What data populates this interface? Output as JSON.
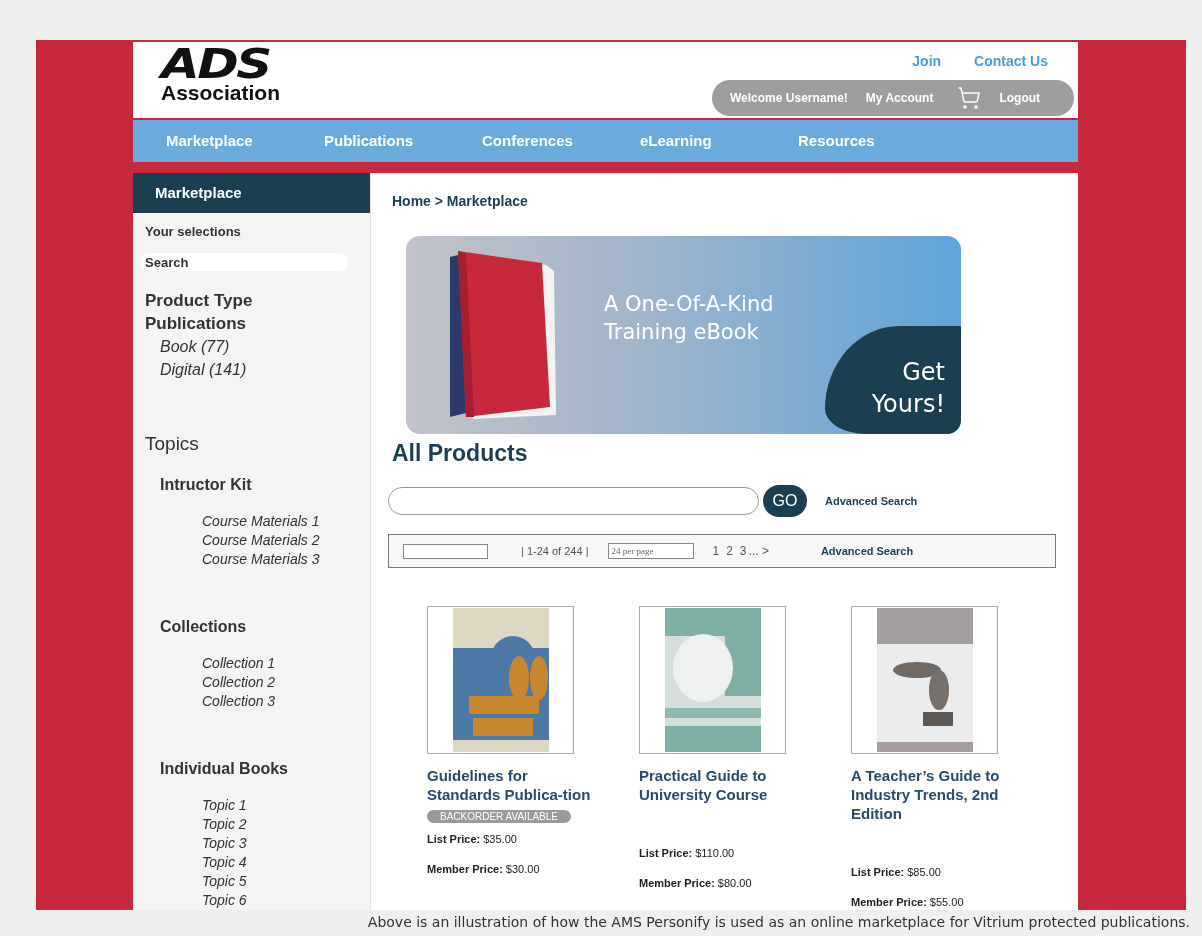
{
  "logo": {
    "mark": "ADS",
    "name": "Association"
  },
  "top_links": [
    "Join",
    "Contact Us"
  ],
  "user_bar": {
    "welcome": "Welcome Username!",
    "account": "My Account",
    "logout": "Logout"
  },
  "nav": [
    "Marketplace",
    "Publications",
    "Conferences",
    "eLearning",
    "Resources"
  ],
  "sidebar": {
    "title": "Marketplace",
    "selections": "Your selections",
    "search": {
      "placeholder": "Search"
    },
    "product_type": {
      "title": "Product Type",
      "subtitle": "Publications",
      "items": [
        "Book (77)",
        "Digital (141)"
      ]
    },
    "topics": {
      "title": "Topics",
      "groups": [
        {
          "title": "Intructor Kit",
          "items": [
            "Course Materials 1",
            "Course Materials 2",
            "Course Materials 3"
          ]
        },
        {
          "title": "Collections",
          "items": [
            "Collection 1",
            "Collection 2",
            "Collection 3"
          ]
        },
        {
          "title": "Individual Books",
          "items": [
            "Topic 1",
            "Topic 2",
            "Topic 3",
            "Topic 4",
            "Topic 5",
            "Topic 6"
          ]
        }
      ]
    }
  },
  "breadcrumb": "Home > Marketplace",
  "banner": {
    "headline": "A One-Of-A-Kind Training eBook",
    "cta": "Get Yours!"
  },
  "section_title": "All Products",
  "search": {
    "button": "GO",
    "advanced": "Advanced Search"
  },
  "pager": {
    "range": "| 1-24 of 244 |",
    "per_page": {
      "placeholder": "24 per page"
    },
    "pages": [
      "1",
      "2",
      "3"
    ],
    "next": "... >",
    "advanced": "Advanced Search"
  },
  "products": [
    {
      "title": "Guidelines for Standards Publica-tion",
      "badge": "BACKORDER AVAILABLE",
      "list_price": "**List Price:** $35.00",
      "member_price": "**Member Price:** $30.00"
    },
    {
      "title": "Practical Guide to University Course",
      "list_price": "**List Price:** $110.00",
      "member_price": "**Member Price:** $80.00"
    },
    {
      "title": "A Teacher’s Guide to Industry Trends, 2nd Edition",
      "list_price": "**List Price:** $85.00",
      "member_price": "**Member Price:** $55.00"
    }
  ],
  "caption": "Above is an illustration of how the AMS Personify is used as an online marketplace for Vitrium protected publications."
}
